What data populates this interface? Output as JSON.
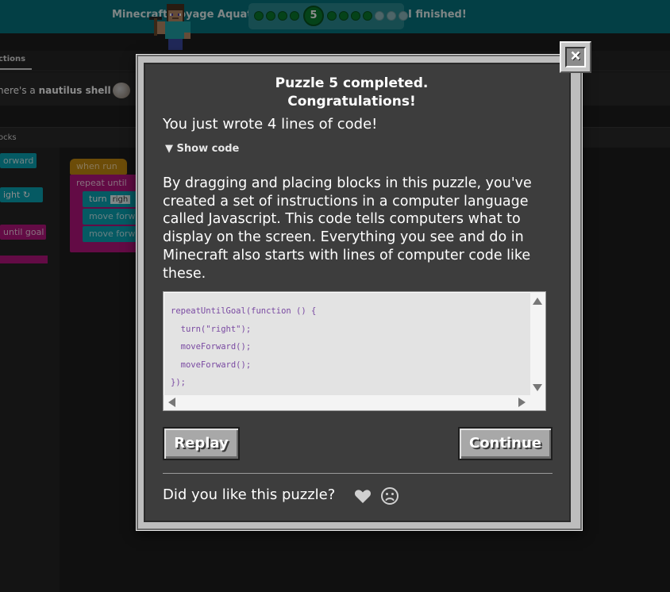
{
  "header": {
    "app_title": "Minecraft Voyage Aquatic",
    "current_level": "5",
    "status_text": "I finished!",
    "dots": [
      "done",
      "done",
      "done",
      "done",
      "current",
      "done",
      "done",
      "done",
      "done",
      "empty",
      "empty",
      "empty"
    ]
  },
  "instructions": {
    "tab_label": "ctions",
    "text_prefix": "here's a ",
    "text_bold": "nautilus shell"
  },
  "blocks_panel": {
    "header_label": "ocks",
    "toolbox": [
      "orward",
      "ight ↻",
      "until goal"
    ],
    "workspace": {
      "when_run": "when run",
      "repeat_label": "repeat until",
      "turn_label": "turn",
      "turn_value": "righ",
      "move1": "move forw",
      "move2": "move forw"
    }
  },
  "dialog": {
    "title_line1": "Puzzle 5 completed.",
    "title_line2": "Congratulations!",
    "lines_message": "You just wrote 4 lines of code!",
    "show_code_label": "▼ Show code",
    "body": "By dragging and placing blocks in this puzzle, you've created a set of instructions in a computer language called Javascript. This code tells computers what to display on the screen. Everything you see and do in Minecraft also starts with lines of computer code like these.",
    "code": "repeatUntilGoal(function () {\n  turn(\"right\");\n  moveForward();\n  moveForward();\n});",
    "replay_label": "Replay",
    "continue_label": "Continue",
    "feedback_question": "Did you like this puzzle?",
    "close_glyph": "×"
  },
  "colors": {
    "topbar": "#07747e",
    "dialog_bg": "#3d3d3d",
    "button_gray": "#a8a8a8",
    "code_text": "#7a4aa2",
    "progress_green": "#0a7a2e"
  }
}
